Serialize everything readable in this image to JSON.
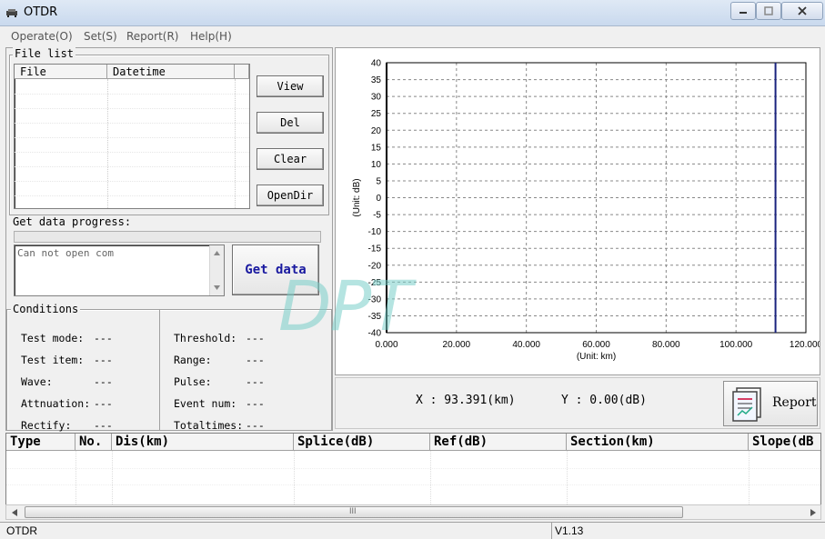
{
  "window": {
    "title": "OTDR",
    "minimize_icon": "minimize-icon",
    "maximize_icon": "maximize-icon",
    "close_icon": "close-icon"
  },
  "menu": [
    {
      "label": "Operate(O)"
    },
    {
      "label": "Set(S)"
    },
    {
      "label": "Report(R)"
    },
    {
      "label": "Help(H)"
    }
  ],
  "file_list": {
    "title": "File list",
    "columns": [
      "File",
      "Datetime"
    ],
    "buttons": {
      "view": "View",
      "del": "Del",
      "clear": "Clear",
      "opendir": "OpenDir"
    }
  },
  "progress": {
    "label": "Get data progress:",
    "log_text": "Can not open com",
    "get_data_label": "Get data"
  },
  "conditions": {
    "title": "Conditions",
    "left": [
      {
        "label": "Test mode:",
        "value": "---"
      },
      {
        "label": "Test item:",
        "value": "---"
      },
      {
        "label": "Wave:",
        "value": "---"
      },
      {
        "label": "Attnuation:",
        "value": "---"
      },
      {
        "label": "Rectify:",
        "value": "---"
      }
    ],
    "right": [
      {
        "label": "Threshold:",
        "value": "---"
      },
      {
        "label": "Range:",
        "value": "---"
      },
      {
        "label": "Pulse:",
        "value": "---"
      },
      {
        "label": "Event num:",
        "value": "---"
      },
      {
        "label": "Totaltimes:",
        "value": "---"
      }
    ]
  },
  "watermark": "DPT",
  "chart_data": {
    "type": "line",
    "title": "",
    "xlabel": "(Unit: km)",
    "ylabel": "(Unit: dB)",
    "xlim": [
      0,
      120
    ],
    "ylim": [
      -40,
      40
    ],
    "x_ticks": [
      0,
      20,
      40,
      60,
      80,
      100,
      120
    ],
    "x_tick_labels": [
      "0.000",
      "20.000",
      "40.000",
      "60.000",
      "80.000",
      "100.000",
      "120.000"
    ],
    "y_ticks": [
      40,
      35,
      30,
      25,
      20,
      15,
      10,
      5,
      0,
      -5,
      -10,
      -15,
      -20,
      -25,
      -30,
      -35,
      -40
    ],
    "grid": true,
    "cursor_x": 111.3,
    "cursor_color": "#1a237e",
    "series": []
  },
  "readout": {
    "x": "X : 93.391(km)",
    "y": "Y : 0.00(dB)"
  },
  "report_button": {
    "label": "Report",
    "icon": "report-icon"
  },
  "events_table": {
    "columns": [
      "Type",
      "No.",
      "Dis(km)",
      "Splice(dB)",
      "Ref(dB)",
      "Section(km)",
      "Slope(dB"
    ],
    "rows": []
  },
  "scrollbar": {
    "grip_glyph": "III"
  },
  "status": {
    "left": "OTDR",
    "version": "V1.13"
  }
}
